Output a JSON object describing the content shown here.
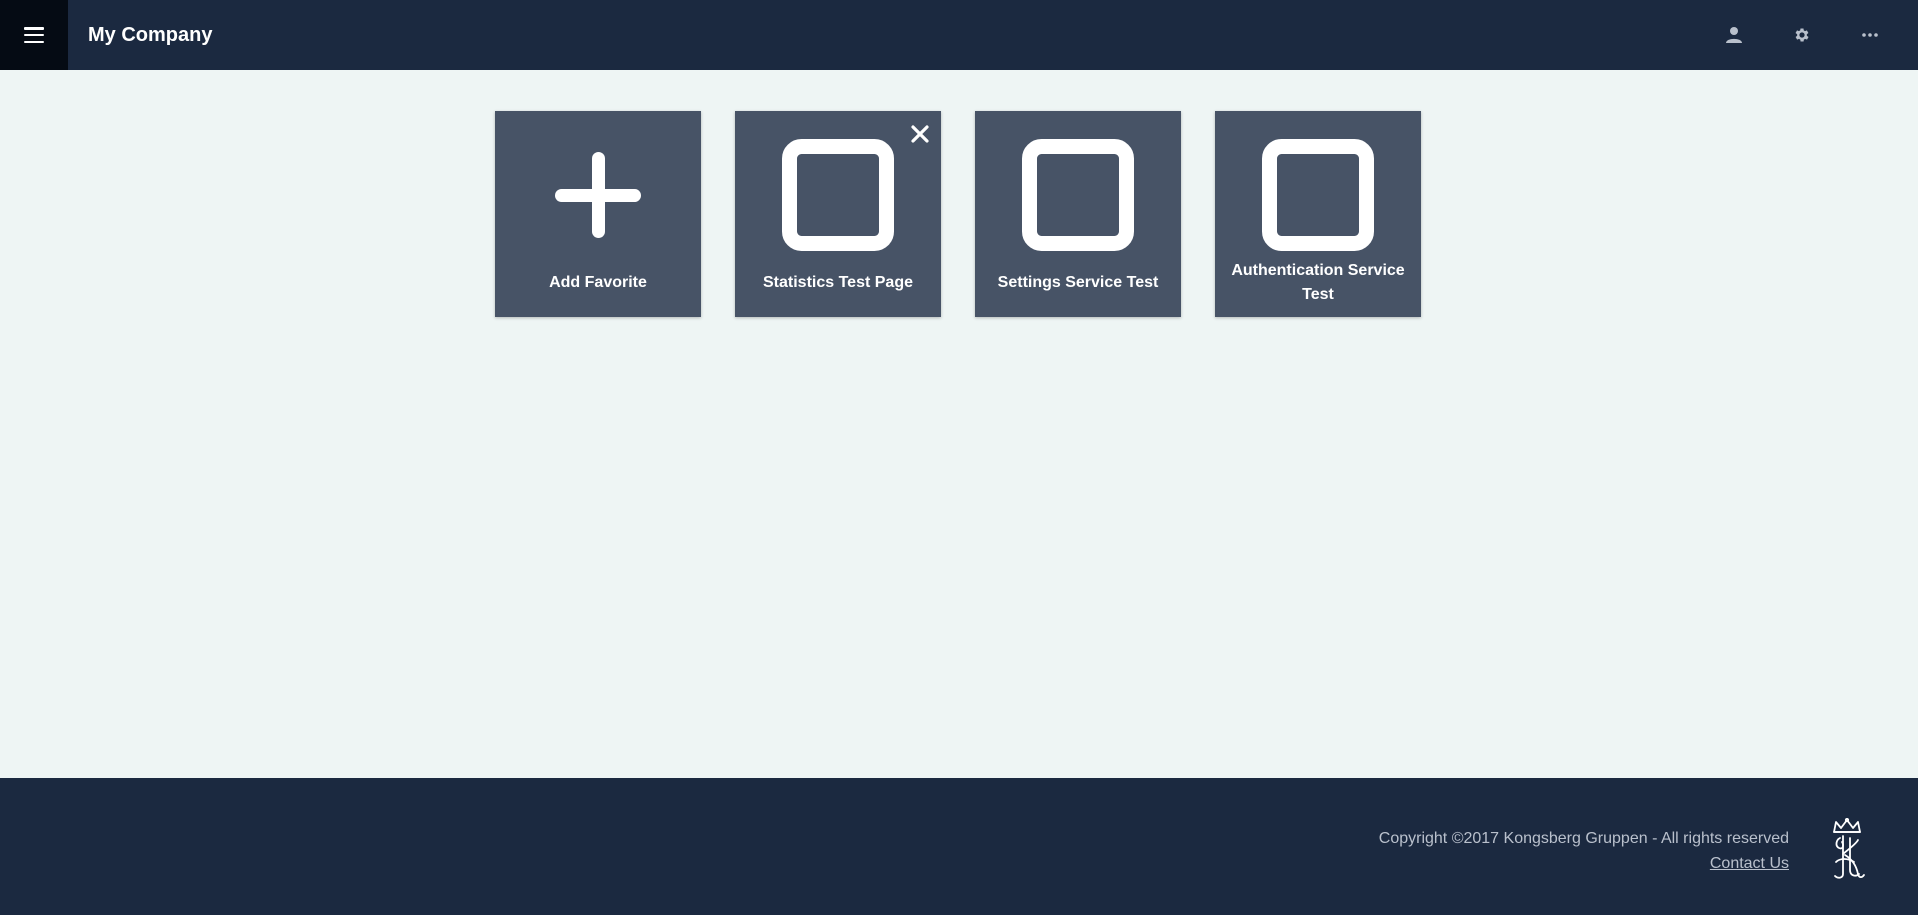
{
  "header": {
    "title": "My Company",
    "menu_icon": "hamburger-menu-icon",
    "actions": [
      {
        "icon": "user-icon"
      },
      {
        "icon": "gear-icon"
      },
      {
        "icon": "more-horizontal-icon"
      }
    ]
  },
  "tiles": [
    {
      "label": "Add Favorite",
      "icon": "plus-icon",
      "closable": false
    },
    {
      "label": "Statistics Test Page",
      "icon": "square-icon",
      "closable": true,
      "close_icon": "close-icon"
    },
    {
      "label": "Settings Service Test",
      "icon": "square-icon",
      "closable": false
    },
    {
      "label": "Authentication Service Test",
      "icon": "square-icon",
      "closable": false
    }
  ],
  "footer": {
    "copyright": "Copyright ©2017 Kongsberg Gruppen - All rights reserved",
    "contact_link": "Contact Us",
    "logo_icon": "kongsberg-crown-logo"
  },
  "colors": {
    "header_bg": "#1b2940",
    "menu_button_bg": "#050b14",
    "page_bg": "#eef5f4",
    "tile_bg": "#475366",
    "footer_text": "#b9c0cc"
  }
}
